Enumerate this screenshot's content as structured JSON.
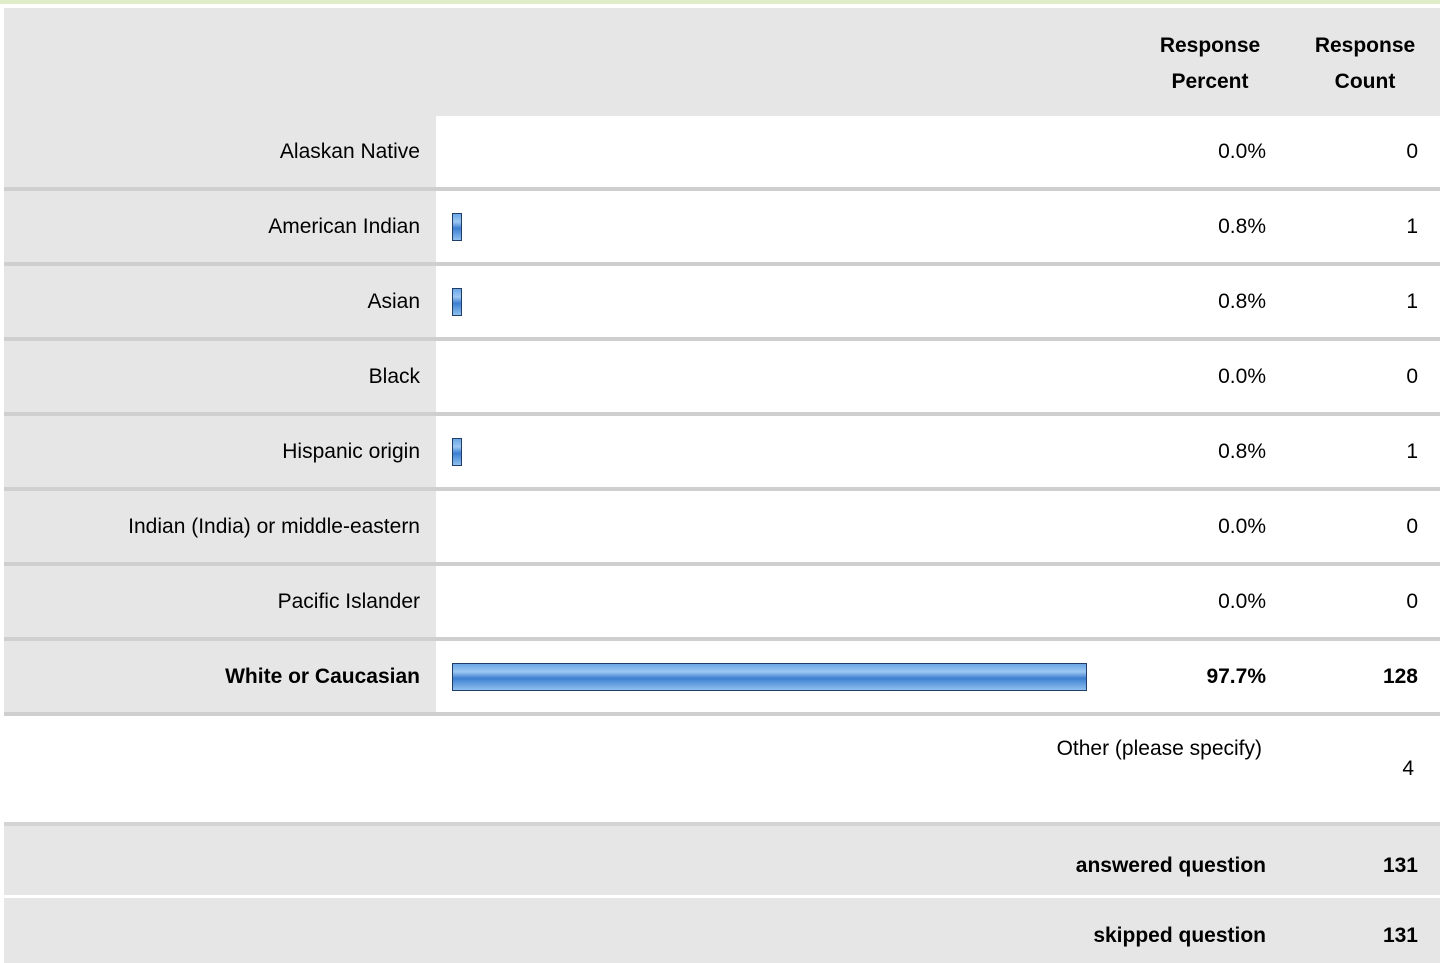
{
  "header": {
    "percent_label": "Response Percent",
    "count_label": "Response Count"
  },
  "chart_data": {
    "type": "bar",
    "orientation": "horizontal",
    "categories": [
      "Alaskan Native",
      "American Indian",
      "Asian",
      "Black",
      "Hispanic origin",
      "Indian (India) or middle-eastern",
      "Pacific Islander",
      "White or Caucasian"
    ],
    "percent_labels": [
      "0.0%",
      "0.8%",
      "0.8%",
      "0.0%",
      "0.8%",
      "0.0%",
      "0.0%",
      "97.7%"
    ],
    "values": [
      0.0,
      0.8,
      0.8,
      0.0,
      0.8,
      0.0,
      0.0,
      97.7
    ],
    "counts": [
      "0",
      "1",
      "1",
      "0",
      "1",
      "0",
      "0",
      "128"
    ],
    "highlighted_index": 7,
    "xlim": [
      0,
      100
    ]
  },
  "other": {
    "label": "Other (please specify)",
    "count": "4"
  },
  "footer": {
    "answered_label": "answered question",
    "answered_value": "131",
    "skipped_label": "skipped question",
    "skipped_value": "131"
  },
  "colors": {
    "bar_fill": "#6aa6e6",
    "bar_border": "#1f3d66",
    "label_bg": "#e6e6e6",
    "separator": "#cfcfcf",
    "top_accent": "#e1ecc8"
  }
}
